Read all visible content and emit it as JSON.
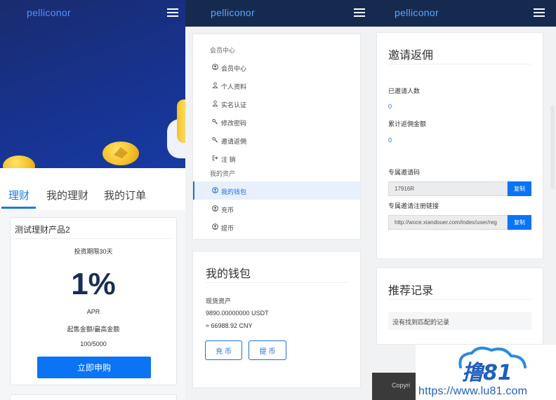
{
  "brand": "pelliconor",
  "panel1": {
    "tabs": [
      "理财",
      "我的理财",
      "我的订单"
    ],
    "product": {
      "name": "测试理财产品2",
      "period": "投资期限30天",
      "rate": "1%",
      "rate_label": "APR",
      "amount_label": "起售金额/最高金额",
      "amount": "100/5000",
      "button": "立即申购"
    }
  },
  "panel2": {
    "sections": [
      "会员中心",
      "我的资产"
    ],
    "items_member": [
      {
        "label": "会员中心",
        "icon": "user-circle-icon"
      },
      {
        "label": "个人资料",
        "icon": "user-icon"
      },
      {
        "label": "实名认证",
        "icon": "user-icon"
      },
      {
        "label": "修改密码",
        "icon": "key-icon"
      },
      {
        "label": "邀请返佣",
        "icon": "key-icon"
      },
      {
        "label": "注 销",
        "icon": "logout-icon"
      }
    ],
    "items_assets": [
      {
        "label": "我的钱包",
        "icon": "user-circle-icon",
        "active": true
      },
      {
        "label": "充币",
        "icon": "user-circle-icon"
      },
      {
        "label": "提币",
        "icon": "user-circle-icon"
      }
    ],
    "wallet": {
      "title": "我的钱包",
      "assets_label": "现货资产",
      "usdt": "9890.00000000 USDT",
      "cny": "≈ 66988.92 CNY",
      "deposit_button": "充 币",
      "withdraw_button": "提 币"
    }
  },
  "panel3": {
    "invite": {
      "title": "邀请返佣",
      "invited_label": "已邀请人数",
      "invited_value": "0",
      "commission_label": "累计返佣金额",
      "commission_value": "0",
      "code_label": "专属邀请码",
      "code_value": "17916R",
      "link_label": "专属邀请注册链接",
      "link_value": "http://woce.xiandouer.com/index/user/reg",
      "copy_button": "复制"
    },
    "records": {
      "title": "推荐记录",
      "empty": "没有找到匹配的记录"
    },
    "footer": "Copyri"
  },
  "watermark": {
    "logo": "撸81",
    "url": "https://www.lu81.com"
  },
  "colors": {
    "navbar": "#162a4f",
    "accent": "#0a74f5",
    "brand_text": "#5aa6ff"
  }
}
